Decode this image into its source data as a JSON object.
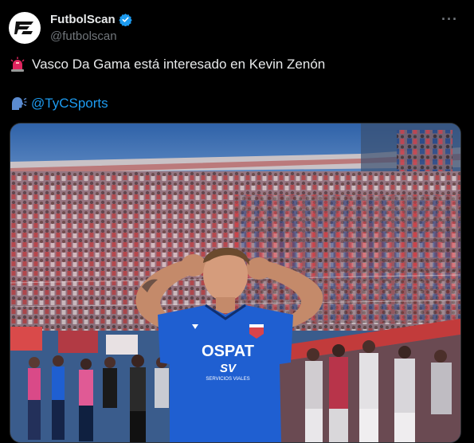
{
  "tweet": {
    "display_name": "FutbolScan",
    "handle": "@futbolscan",
    "verified": true,
    "more_label": "···",
    "line1_emoji": "siren-icon",
    "line1_text": "Vasco Da Gama está interesado en Kevin Zenón",
    "line2_emoji": "speaking-head-icon",
    "line2_mention": "@TyCSports"
  },
  "media": {
    "jersey_sponsor": "OSPAT",
    "jersey_sub_logo": "SV",
    "jersey_sub_text": "SERVICIOS VIALES"
  },
  "colors": {
    "background": "#000000",
    "text": "#e7e9ea",
    "secondary_text": "#71767b",
    "accent": "#1d9bf0",
    "jersey_blue": "#1f5fd1"
  }
}
